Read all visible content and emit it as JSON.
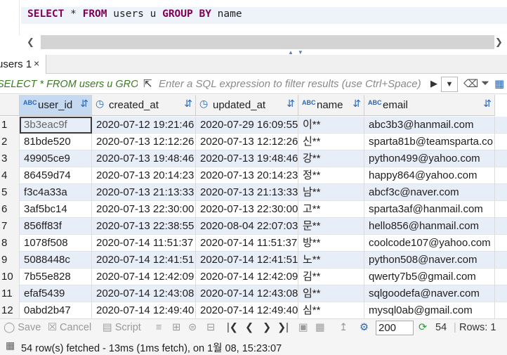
{
  "editor": {
    "kw_select": "SELECT",
    "star": "*",
    "kw_from": "FROM",
    "table": "users u",
    "kw_group_by": "GROUP BY",
    "group_col": "name"
  },
  "result_tab": {
    "label": "users 1",
    "close": "×"
  },
  "filter": {
    "query_preview": "SELECT * FROM users u GROUP BY name",
    "placeholder": "Enter a SQL expression to filter results (use Ctrl+Space)"
  },
  "columns": [
    {
      "name": "user_id",
      "type_icon": "ABC",
      "kind": "text"
    },
    {
      "name": "created_at",
      "type_icon": "clock",
      "kind": "datetime"
    },
    {
      "name": "updated_at",
      "type_icon": "clock",
      "kind": "datetime"
    },
    {
      "name": "name",
      "type_icon": "ABC",
      "kind": "text"
    },
    {
      "name": "email",
      "type_icon": "ABC",
      "kind": "text"
    }
  ],
  "rows": [
    {
      "n": "1",
      "user_id": "3b3eac9f",
      "created_at": "2020-07-12 19:21:46",
      "updated_at": "2020-07-29 16:09:55",
      "name": "이**",
      "email": "abc3b3@hanmail.com"
    },
    {
      "n": "2",
      "user_id": "81bde520",
      "created_at": "2020-07-13 12:12:26",
      "updated_at": "2020-07-13 12:12:26",
      "name": "신**",
      "email": "sparta81b@teamsparta.co"
    },
    {
      "n": "3",
      "user_id": "49905ce9",
      "created_at": "2020-07-13 19:48:46",
      "updated_at": "2020-07-13 19:48:46",
      "name": "강**",
      "email": "python499@yahoo.com"
    },
    {
      "n": "4",
      "user_id": "86459d74",
      "created_at": "2020-07-13 20:14:23",
      "updated_at": "2020-07-13 20:14:23",
      "name": "정**",
      "email": "happy864@yahoo.com"
    },
    {
      "n": "5",
      "user_id": "f3c4a33a",
      "created_at": "2020-07-13 21:13:33",
      "updated_at": "2020-07-13 21:13:33",
      "name": "남**",
      "email": "abcf3c@naver.com"
    },
    {
      "n": "6",
      "user_id": "3af5bc14",
      "created_at": "2020-07-13 22:30:00",
      "updated_at": "2020-07-13 22:30:00",
      "name": "고**",
      "email": "sparta3af@hanmail.com"
    },
    {
      "n": "7",
      "user_id": "856ff83f",
      "created_at": "2020-07-13 22:38:55",
      "updated_at": "2020-08-04 22:07:03",
      "name": "문**",
      "email": "hello856@hanmail.com"
    },
    {
      "n": "8",
      "user_id": "1078f508",
      "created_at": "2020-07-14 11:51:37",
      "updated_at": "2020-07-14 11:51:37",
      "name": "방**",
      "email": "coolcode107@yahoo.com"
    },
    {
      "n": "9",
      "user_id": "5088448c",
      "created_at": "2020-07-14 12:41:51",
      "updated_at": "2020-07-14 12:41:51",
      "name": "노**",
      "email": "python508@naver.com"
    },
    {
      "n": "10",
      "user_id": "7b55e828",
      "created_at": "2020-07-14 12:42:09",
      "updated_at": "2020-07-14 12:42:09",
      "name": "김**",
      "email": "qwerty7b5@gmail.com"
    },
    {
      "n": "11",
      "user_id": "efaf5439",
      "created_at": "2020-07-14 12:43:08",
      "updated_at": "2020-07-14 12:43:08",
      "name": "임**",
      "email": "sqlgoodefa@naver.com"
    },
    {
      "n": "12",
      "user_id": "0abd2b47",
      "created_at": "2020-07-14 12:49:40",
      "updated_at": "2020-07-14 12:49:40",
      "name": "심**",
      "email": "mysql0ab@gmail.com"
    }
  ],
  "toolbar": {
    "save": "Save",
    "cancel": "Cancel",
    "script": "Script",
    "fetch_size": "200",
    "fetched_count": "54",
    "rows_label": "Rows: 1"
  },
  "status": {
    "text": "54 row(s) fetched - 13ms (1ms fetch), on 1월 08, 15:23:07"
  },
  "colors": {
    "keyword": "#7f0055",
    "accent": "#2a66b5",
    "filter_query": "#3a7a22"
  }
}
